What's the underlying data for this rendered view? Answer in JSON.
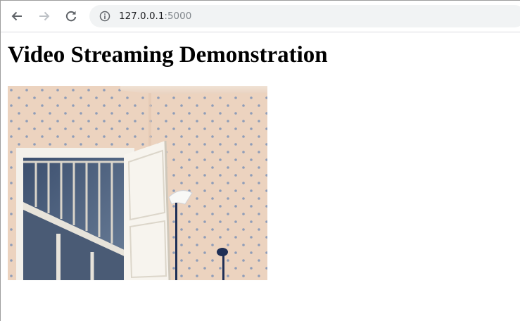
{
  "browser": {
    "url_host": "127.0.0.1",
    "url_port": ":5000",
    "icons": {
      "back": "back-arrow-icon",
      "forward": "forward-arrow-icon",
      "reload": "reload-icon",
      "site_info": "info-icon"
    },
    "forward_enabled": false
  },
  "page": {
    "title": "Video Streaming Demonstration",
    "video_feed": {
      "content": "live camera frame: hallway with open white door, staircase and floor lamps",
      "colors": {
        "wallpaper": "#ecd3bf",
        "dot": "#8f9db8",
        "door": "#f4f1eb",
        "stairs": "#5b6f8c"
      }
    }
  }
}
